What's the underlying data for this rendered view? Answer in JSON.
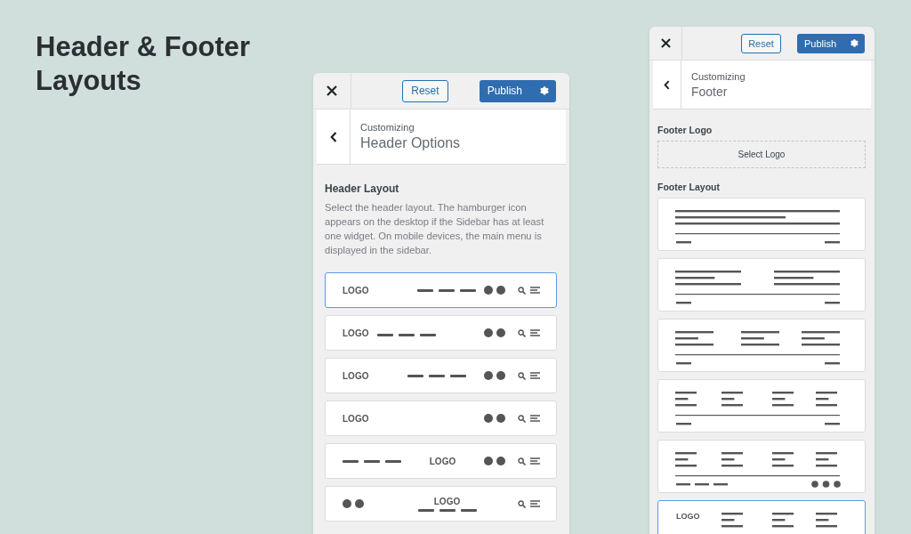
{
  "heading": "Header & Footer Layouts",
  "header_panel": {
    "reset": "Reset",
    "publish": "Publish",
    "breadcrumb": "Customizing",
    "title": "Header Options",
    "section_title": "Header Layout",
    "description": "Select the header layout. The hamburger icon appears on the desktop if the Sidebar has at least one widget. On mobile devices, the main menu is displayed in the sidebar.",
    "layouts": [
      {
        "kind": "logo-menu-right",
        "logo": "LOGO",
        "selected": true
      },
      {
        "kind": "logo-menu-left",
        "logo": "LOGO",
        "selected": false
      },
      {
        "kind": "logo-menu-center",
        "logo": "LOGO",
        "selected": false
      },
      {
        "kind": "logo-only",
        "logo": "LOGO",
        "selected": false
      },
      {
        "kind": "menu-logo-center",
        "logo": "LOGO",
        "selected": false
      },
      {
        "kind": "stacked-center",
        "logo": "LOGO",
        "selected": false
      }
    ]
  },
  "footer_panel": {
    "reset": "Reset",
    "publish": "Publish",
    "breadcrumb": "Customizing",
    "title": "Footer",
    "logo_label": "Footer Logo",
    "select_logo": "Select Logo",
    "section_title": "Footer Layout",
    "layouts": [
      {
        "kind": "one-column",
        "selected": false
      },
      {
        "kind": "two-columns",
        "selected": false
      },
      {
        "kind": "three-columns",
        "selected": false
      },
      {
        "kind": "four-columns",
        "selected": false
      },
      {
        "kind": "four-columns-social",
        "selected": false
      },
      {
        "kind": "logo-columns",
        "logo": "LOGO",
        "selected": true
      }
    ]
  }
}
